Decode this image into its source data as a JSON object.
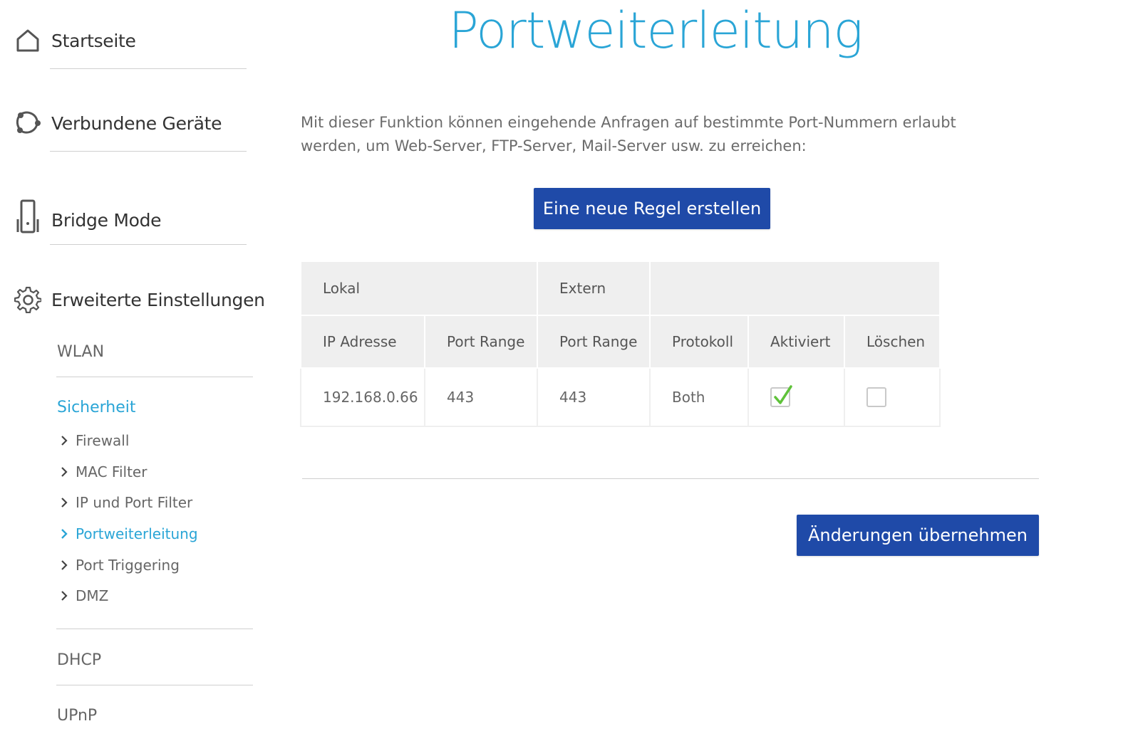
{
  "colors": {
    "accent": "#2aa5d6",
    "button": "#1f4aa8",
    "check_green": "#5fc23a"
  },
  "sidebar": {
    "main_items": [
      {
        "label": "Startseite",
        "icon": "home-icon"
      },
      {
        "label": "Verbundene Geräte",
        "icon": "connected-devices-icon"
      },
      {
        "label": "Bridge Mode",
        "icon": "router-device-icon"
      },
      {
        "label": "Erweiterte Einstellungen",
        "icon": "gear-icon"
      }
    ],
    "sub_sections": {
      "wlan": "WLAN",
      "security": "Sicherheit",
      "dhcp": "DHCP",
      "upnp": "UPnP"
    },
    "security_items": [
      {
        "label": "Firewall"
      },
      {
        "label": "MAC Filter"
      },
      {
        "label": "IP und Port Filter"
      },
      {
        "label": "Portweiterleitung",
        "active": true
      },
      {
        "label": "Port Triggering"
      },
      {
        "label": "DMZ"
      }
    ]
  },
  "main": {
    "title": "Portweiterleitung",
    "description": "Mit dieser Funktion können eingehende Anfragen auf bestimmte Port-Nummern erlaubt werden, um Web-Server, FTP-Server, Mail-Server usw. zu erreichen:",
    "new_rule_button": "Eine neue Regel erstellen",
    "apply_button": "Änderungen übernehmen",
    "table": {
      "group_headers": {
        "local": "Lokal",
        "external": "Extern"
      },
      "columns": [
        "IP Adresse",
        "Port Range",
        "Port Range",
        "Protokoll",
        "Aktiviert",
        "Löschen"
      ],
      "rows": [
        {
          "ip": "192.168.0.66",
          "local_port_range": "443",
          "external_port_range": "443",
          "protocol": "Both",
          "enabled": true,
          "delete": false
        }
      ]
    }
  }
}
